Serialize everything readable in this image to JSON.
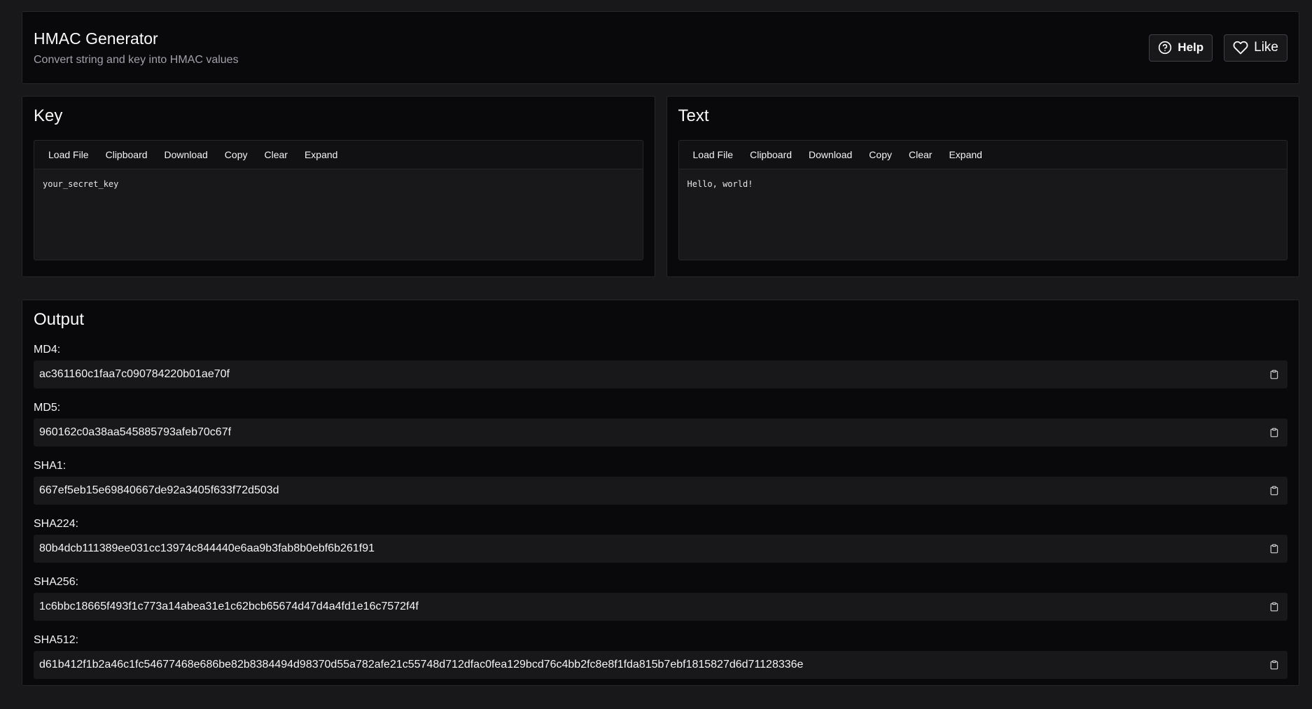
{
  "header": {
    "title": "HMAC Generator",
    "subtitle": "Convert string and key into HMAC values",
    "help_label": "Help",
    "like_label": "Like"
  },
  "key_panel": {
    "title": "Key",
    "toolbar": [
      "Load File",
      "Clipboard",
      "Download",
      "Copy",
      "Clear",
      "Expand"
    ],
    "content": "your_secret_key"
  },
  "text_panel": {
    "title": "Text",
    "toolbar": [
      "Load File",
      "Clipboard",
      "Download",
      "Copy",
      "Clear",
      "Expand"
    ],
    "content": "Hello, world!"
  },
  "output": {
    "title": "Output",
    "hashes": [
      {
        "label": "MD4:",
        "value": "ac361160c1faa7c090784220b01ae70f"
      },
      {
        "label": "MD5:",
        "value": "960162c0a38aa545885793afeb70c67f"
      },
      {
        "label": "SHA1:",
        "value": "667ef5eb15e69840667de92a3405f633f72d503d"
      },
      {
        "label": "SHA224:",
        "value": "80b4dcb111389ee031cc13974c844440e6aa9b3fab8b0ebf6b261f91"
      },
      {
        "label": "SHA256:",
        "value": "1c6bbc18665f493f1c773a14abea31e1c62bcb65674d47d4a4fd1e16c7572f4f"
      },
      {
        "label": "SHA512:",
        "value": "d61b412f1b2a46c1fc54677468e686be82b8384494d98370d55a782afe21c55748d712dfac0fea129bcd76c4bb2fc8e8f1fda815b7ebf1815827d6d71128336e"
      }
    ]
  },
  "colors": {
    "background": "#18181b",
    "card": "#09090b",
    "border": "#27272a",
    "text": "#fafafa",
    "muted": "#a1a1aa"
  },
  "icons": {
    "help": "help-circle-icon",
    "like": "heart-icon",
    "copy": "clipboard-icon"
  }
}
